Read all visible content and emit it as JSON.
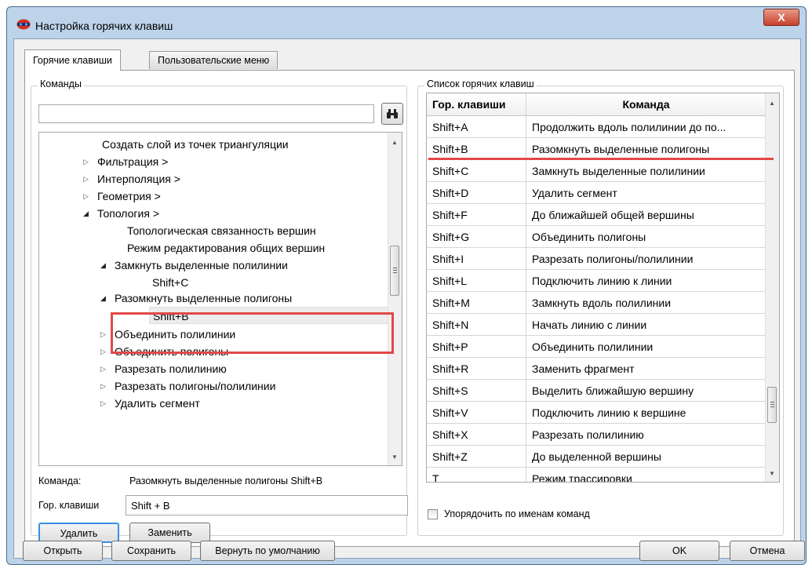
{
  "window": {
    "title": "Настройка горячих клавиш",
    "close_glyph": "X"
  },
  "tabs": [
    {
      "label": "Горячие клавиши",
      "active": true
    },
    {
      "label": "Пользовательские меню",
      "active": false
    }
  ],
  "commands_group": {
    "label": "Команды",
    "search_value": "",
    "search_icon": "binoculars-icon",
    "tree": [
      {
        "label": "Создать слой из точек триангуляции",
        "arrow": ""
      },
      {
        "label": "Фильтрация >",
        "arrow": "▷"
      },
      {
        "label": "Интерполяция >",
        "arrow": "▷"
      },
      {
        "label": "Геометрия >",
        "arrow": "▷"
      },
      {
        "label": "Топология >",
        "arrow": "◢"
      },
      {
        "label": "Топологическая связанность вершин",
        "arrow": ""
      },
      {
        "label": "Режим редактирования общих вершин",
        "arrow": ""
      },
      {
        "label": "Замкнуть выделенные полилинии",
        "arrow": "◢"
      },
      {
        "label": "Shift+C",
        "arrow": ""
      },
      {
        "label": "Разомкнуть выделенные полигоны",
        "arrow": "◢"
      },
      {
        "label": "Shift+B",
        "arrow": ""
      },
      {
        "label": "Объединить полилинии",
        "arrow": "▷"
      },
      {
        "label": "Объединить полигоны",
        "arrow": "▷"
      },
      {
        "label": "Разрезать полилинию",
        "arrow": "▷"
      },
      {
        "label": "Разрезать полигоны/полилинии",
        "arrow": "▷"
      },
      {
        "label": "Удалить сегмент",
        "arrow": "▷"
      }
    ],
    "command_label": "Команда:",
    "command_value": "Разомкнуть выделенные полигоны Shift+B",
    "hotkey_label": "Гор. клавиши",
    "hotkey_value": "Shift + B",
    "delete_button": "Удалить",
    "replace_button": "Заменить"
  },
  "hotkeys_group": {
    "label": "Список горячих клавиш",
    "columns": [
      "Гор. клавиши",
      "Команда"
    ],
    "rows": [
      [
        "Shift+A",
        "Продолжить вдоль полилинии до по..."
      ],
      [
        "Shift+B",
        "Разомкнуть выделенные полигоны"
      ],
      [
        "Shift+C",
        "Замкнуть выделенные полилинии"
      ],
      [
        "Shift+D",
        "Удалить сегмент"
      ],
      [
        "Shift+F",
        "До ближайшей общей вершины"
      ],
      [
        "Shift+G",
        "Объединить полигоны"
      ],
      [
        "Shift+I",
        "Разрезать полигоны/полилинии"
      ],
      [
        "Shift+L",
        "Подключить линию к линии"
      ],
      [
        "Shift+M",
        "Замкнуть вдоль полилинии"
      ],
      [
        "Shift+N",
        "Начать линию с линии"
      ],
      [
        "Shift+P",
        "Объединить полилинии"
      ],
      [
        "Shift+R",
        "Заменить фрагмент"
      ],
      [
        "Shift+S",
        "Выделить ближайшую вершину"
      ],
      [
        "Shift+V",
        "Подключить линию к вершине"
      ],
      [
        "Shift+X",
        "Разрезать полилинию"
      ],
      [
        "Shift+Z",
        "До выделенной вершины"
      ],
      [
        "T",
        "Режим трассировки"
      ]
    ],
    "sort_label": "Упорядочить по именам команд",
    "sort_checked": false
  },
  "footer": {
    "open_button": "Открыть",
    "save_button": "Сохранить",
    "defaults_button": "Вернуть по умолчанию",
    "ok_button": "OK",
    "cancel_button": "Отмена"
  },
  "colors": {
    "highlight": "#e34848",
    "title_bar": "#bcd3ea"
  }
}
